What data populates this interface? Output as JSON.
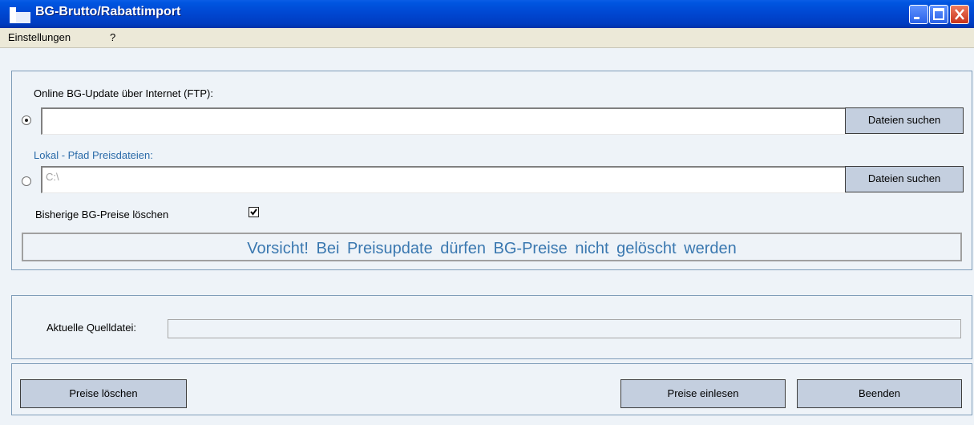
{
  "window": {
    "title": "BG-Brutto/Rabattimport"
  },
  "titlebar_buttons": {
    "minimize_icon": "minimize-icon",
    "maximize_icon": "maximize-icon",
    "close_icon": "close-icon"
  },
  "menu": {
    "items": [
      "Einstellungen",
      "?"
    ]
  },
  "source": {
    "online_label": "Online BG-Update über Internet (FTP):",
    "online_value": "",
    "online_selected": true,
    "local_label": "Lokal - Pfad Preisdateien:",
    "local_value": "C:\\",
    "local_selected": false,
    "search_button_label": "Dateien suchen"
  },
  "delete_option": {
    "label": "Bisherige BG-Preise löschen",
    "checked": true
  },
  "warning": {
    "text": "Vorsicht!   Bei Preisupdate dürfen BG-Preise nicht gelöscht werden"
  },
  "status": {
    "label": "Aktuelle Quelldatei:",
    "value": ""
  },
  "actions": {
    "delete_prices": "Preise löschen",
    "import_prices": "Preise einlesen",
    "exit": "Beenden"
  },
  "colors": {
    "title_bar": "#0046d0",
    "panel_bg": "#eef3f8",
    "panel_border": "#7f9db9",
    "button_bg": "#c4cfdf",
    "warning_text": "#3a78b0",
    "local_label": "#2a6aa8"
  }
}
